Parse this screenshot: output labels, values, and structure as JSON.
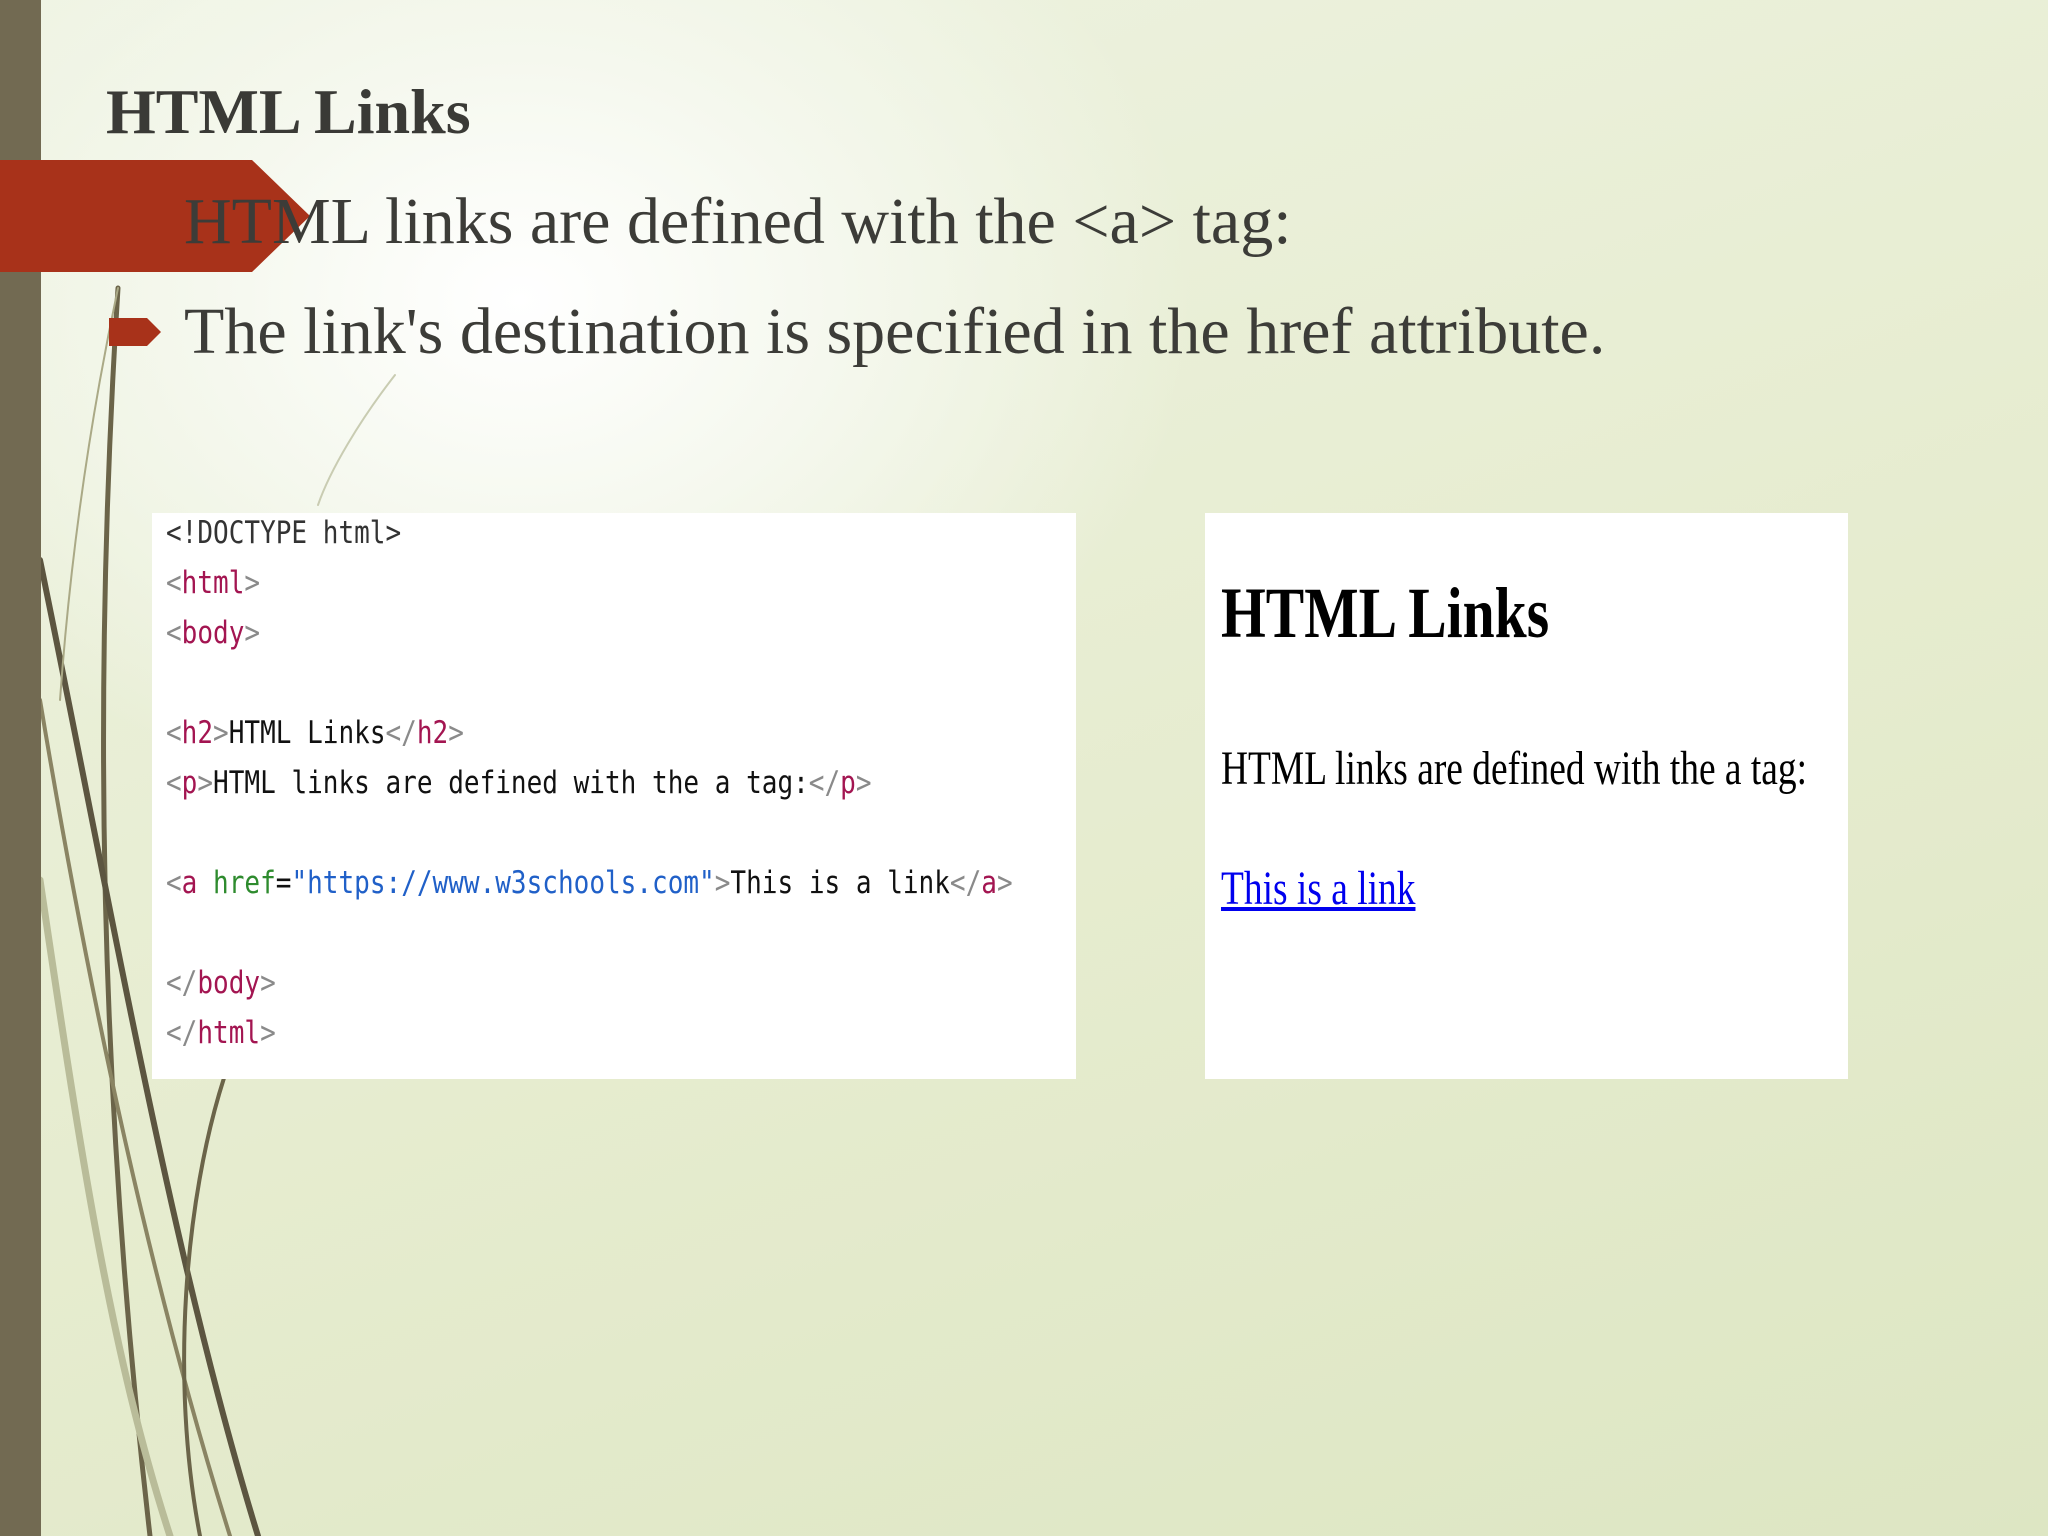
{
  "slide": {
    "title": "HTML Links",
    "bullets": [
      "HTML links are defined with the <a> tag:",
      "The link's destination is specified in the href attribute."
    ],
    "accent_color": "#a8321a",
    "side_bar_color": "#726a52"
  },
  "code_example": {
    "doctype": "<!DOCTYPE html>",
    "html_open": "html",
    "body_open": "body",
    "h2_tag": "h2",
    "h2_text": "HTML Links",
    "p_tag": "p",
    "p_text": "HTML links are defined with the a tag:",
    "a_tag": "a",
    "a_attr": "href",
    "a_value": "\"https://www.w3schools.com\"",
    "a_text": "This is a link",
    "body_close": "body",
    "html_close": "html"
  },
  "rendered_result": {
    "heading": "HTML Links",
    "paragraph": "HTML links are defined with the a tag:",
    "link_text": "This is a link",
    "link_color": "#0000ee"
  }
}
